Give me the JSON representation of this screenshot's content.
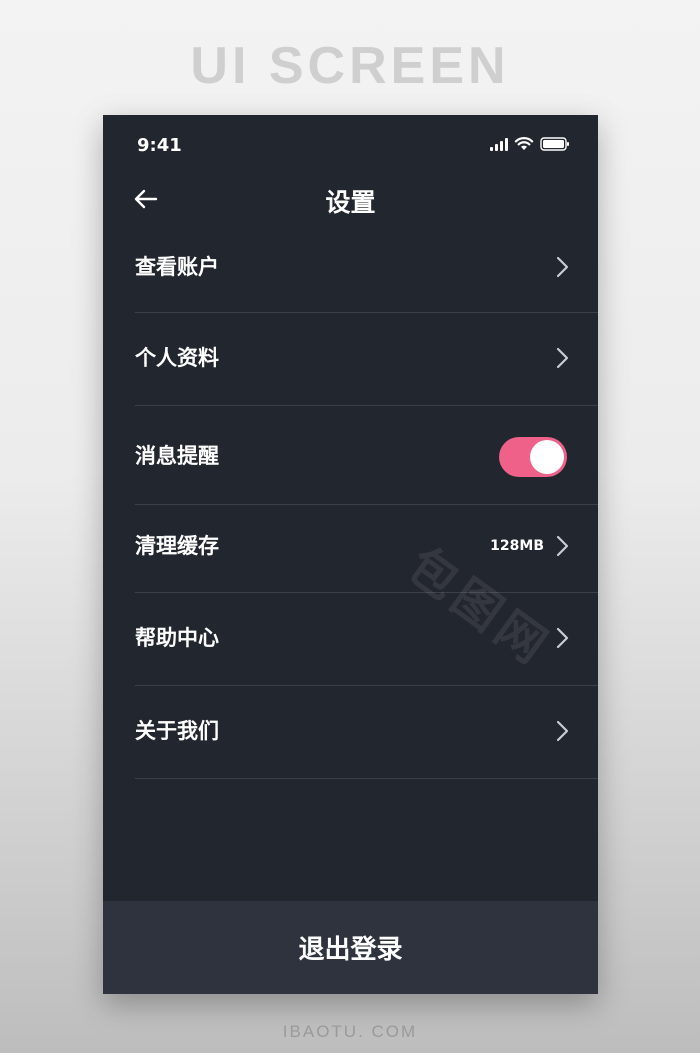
{
  "page": {
    "heading": "UI SCREEN",
    "footer_site": "IBAOTU. COM"
  },
  "status_bar": {
    "time": "9:41",
    "icons": [
      "signal-icon",
      "wifi-icon",
      "battery-icon"
    ]
  },
  "nav": {
    "back_icon": "arrow-left-icon",
    "title": "设置"
  },
  "settings": {
    "items": [
      {
        "label": "查看账户",
        "control": "chevron"
      },
      {
        "label": "个人资料",
        "control": "chevron"
      },
      {
        "label": "消息提醒",
        "control": "toggle",
        "toggle_on": true
      },
      {
        "label": "清理缓存",
        "control": "chevron",
        "value": "128MB"
      },
      {
        "label": "帮助中心",
        "control": "chevron"
      },
      {
        "label": "关于我们",
        "control": "chevron"
      }
    ]
  },
  "logout": {
    "label": "退出登录"
  },
  "watermark": {
    "text": "包图网"
  },
  "colors": {
    "background": "#22262e",
    "logout_bar": "#2e333d",
    "divider": "#3a3f48",
    "accent_toggle": "#ef6189",
    "text": "#ffffff"
  }
}
